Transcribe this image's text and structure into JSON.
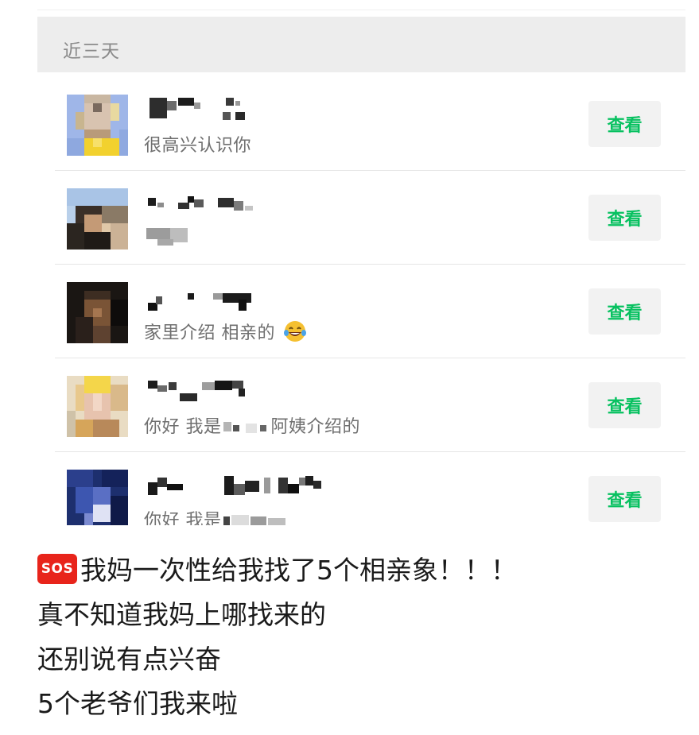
{
  "section": {
    "header": "近三天"
  },
  "requests": [
    {
      "message": "很高兴认识你",
      "button_label": "查看"
    },
    {
      "message": "",
      "button_label": "查看"
    },
    {
      "message": "家里介绍 相亲的",
      "emoji": "laughing-tears-icon",
      "button_label": "查看"
    },
    {
      "message_prefix": "你好 我是",
      "message_suffix": "阿姨介绍的",
      "button_label": "查看"
    },
    {
      "message_prefix": "你好 我是",
      "button_label": "查看"
    }
  ],
  "caption": {
    "sos_label": "SOS",
    "line1": "我妈一次性给我找了5个相亲象！！！",
    "line2": "真不知道我妈上哪找来的",
    "line3": "还别说有点兴奋",
    "line4": "5个老爷们我来啦"
  },
  "colors": {
    "accent_green": "#07c160",
    "sos_red": "#e8241b",
    "header_bg": "#ededed"
  }
}
